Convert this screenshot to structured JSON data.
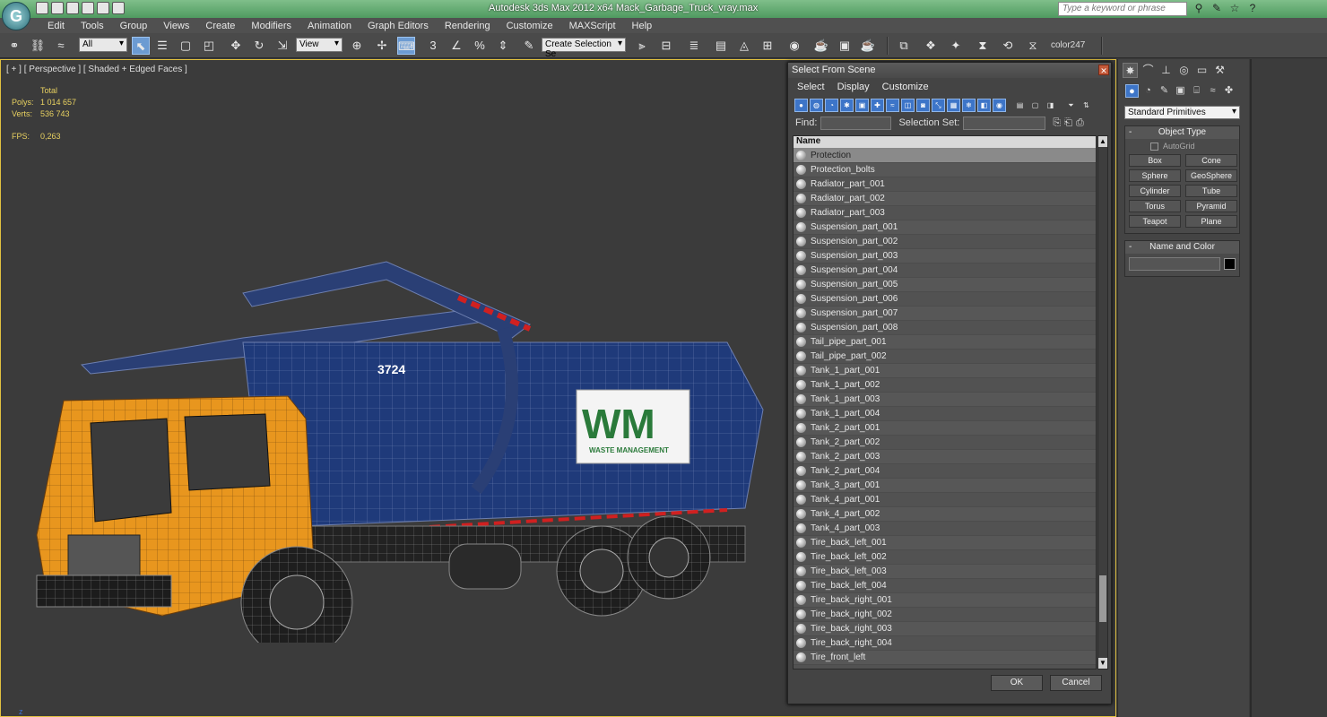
{
  "window": {
    "title": "Autodesk 3ds Max  2012 x64      Mack_Garbage_Truck_vray.max",
    "logo": "3ds-max-logo",
    "search_placeholder": "Type a keyword or phrase"
  },
  "menu": [
    "Edit",
    "Tools",
    "Group",
    "Views",
    "Create",
    "Modifiers",
    "Animation",
    "Graph Editors",
    "Rendering",
    "Customize",
    "MAXScript",
    "Help"
  ],
  "toolbar": {
    "filter_value": "All",
    "ref_coord_value": "View",
    "named_selection_value": "Create Selection Se",
    "color_label": "color247",
    "snap_label": "3"
  },
  "viewport": {
    "label": "[ + ] [ Perspective ] [ Shaded + Edged Faces ]",
    "stats_header": "Total",
    "polys_label": "Polys:",
    "polys_value": "1 014 657",
    "verts_label": "Verts:",
    "verts_value": "536 743",
    "fps_label": "FPS:",
    "fps_value": "0,263",
    "truck_number": "3724",
    "brand_initials": "WM",
    "brand_name": "WASTE MANAGEMENT",
    "axis_label": "z"
  },
  "dialog": {
    "title": "Select From Scene",
    "menu": [
      "Select",
      "Display",
      "Customize"
    ],
    "find_label": "Find:",
    "selection_set_label": "Selection Set:",
    "column_header": "Name",
    "items": [
      "Protection",
      "Protection_bolts",
      "Radiator_part_001",
      "Radiator_part_002",
      "Radiator_part_003",
      "Suspension_part_001",
      "Suspension_part_002",
      "Suspension_part_003",
      "Suspension_part_004",
      "Suspension_part_005",
      "Suspension_part_006",
      "Suspension_part_007",
      "Suspension_part_008",
      "Tail_pipe_part_001",
      "Tail_pipe_part_002",
      "Tank_1_part_001",
      "Tank_1_part_002",
      "Tank_1_part_003",
      "Tank_1_part_004",
      "Tank_2_part_001",
      "Tank_2_part_002",
      "Tank_2_part_003",
      "Tank_2_part_004",
      "Tank_3_part_001",
      "Tank_4_part_001",
      "Tank_4_part_002",
      "Tank_4_part_003",
      "Tire_back_left_001",
      "Tire_back_left_002",
      "Tire_back_left_003",
      "Tire_back_left_004",
      "Tire_back_right_001",
      "Tire_back_right_002",
      "Tire_back_right_003",
      "Tire_back_right_004",
      "Tire_front_left"
    ],
    "ok_label": "OK",
    "cancel_label": "Cancel"
  },
  "command_panel": {
    "category": "Standard Primitives",
    "object_type_title": "Object Type",
    "autogrid_label": "AutoGrid",
    "buttons": [
      "Box",
      "Cone",
      "Sphere",
      "GeoSphere",
      "Cylinder",
      "Tube",
      "Torus",
      "Pyramid",
      "Teapot",
      "Plane"
    ],
    "name_color_title": "Name and Color",
    "object_color": "#000000"
  },
  "colors": {
    "cab": "#e8961e",
    "body": "#1f3a7a",
    "brand_green": "#2a7a3a",
    "brand_yellow": "#e9b21a",
    "accent_blue": "#3d75c8"
  }
}
